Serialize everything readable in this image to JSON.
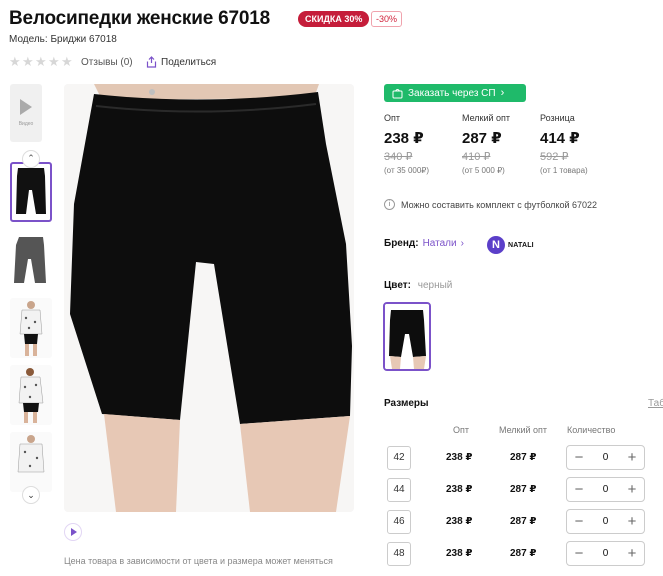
{
  "product": {
    "title": "Велосипедки женские 67018",
    "sale_badge": "СКИДКА 30%",
    "discount_pct": "-30%",
    "model": "Модель: Бриджи 67018",
    "reviews": "Отзывы (0)",
    "share": "Поделиться",
    "rating": 0
  },
  "gallery": {
    "video_label": "Видео",
    "note": "Цена товара в зависимости от цвета и размера может меняться"
  },
  "order": {
    "button": "Заказать через СП"
  },
  "prices": [
    {
      "label": "Опт",
      "value": "238 ₽",
      "old": "340 ₽",
      "note": "(от 35 000₽)"
    },
    {
      "label": "Мелкий опт",
      "value": "287 ₽",
      "old": "410 ₽",
      "note": "(от 5 000 ₽)"
    },
    {
      "label": "Розница",
      "value": "414 ₽",
      "old": "592 ₽",
      "note": "(от 1 товара)"
    }
  ],
  "combo_note": "Можно составить комплект с футболкой 67022",
  "brand": {
    "label": "Бренд:",
    "name": "Натали",
    "logo_text": "NATALI",
    "logo_letter": "N"
  },
  "color": {
    "label": "Цвет:",
    "value": "черный"
  },
  "sizes": {
    "title": "Размеры",
    "table_link": "Таб",
    "columns": {
      "opt": "Опт",
      "small": "Мелкий опт",
      "qty": "Количество"
    },
    "rows": [
      {
        "size": "42",
        "opt": "238 ₽",
        "small": "287 ₽",
        "qty": "0"
      },
      {
        "size": "44",
        "opt": "238 ₽",
        "small": "287 ₽",
        "qty": "0"
      },
      {
        "size": "46",
        "opt": "238 ₽",
        "small": "287 ₽",
        "qty": "0"
      },
      {
        "size": "48",
        "opt": "238 ₽",
        "small": "287 ₽",
        "qty": "0"
      }
    ]
  },
  "colors": {
    "accent": "#7b52c9",
    "sale": "#c51d3a",
    "order": "#1fba6a"
  }
}
